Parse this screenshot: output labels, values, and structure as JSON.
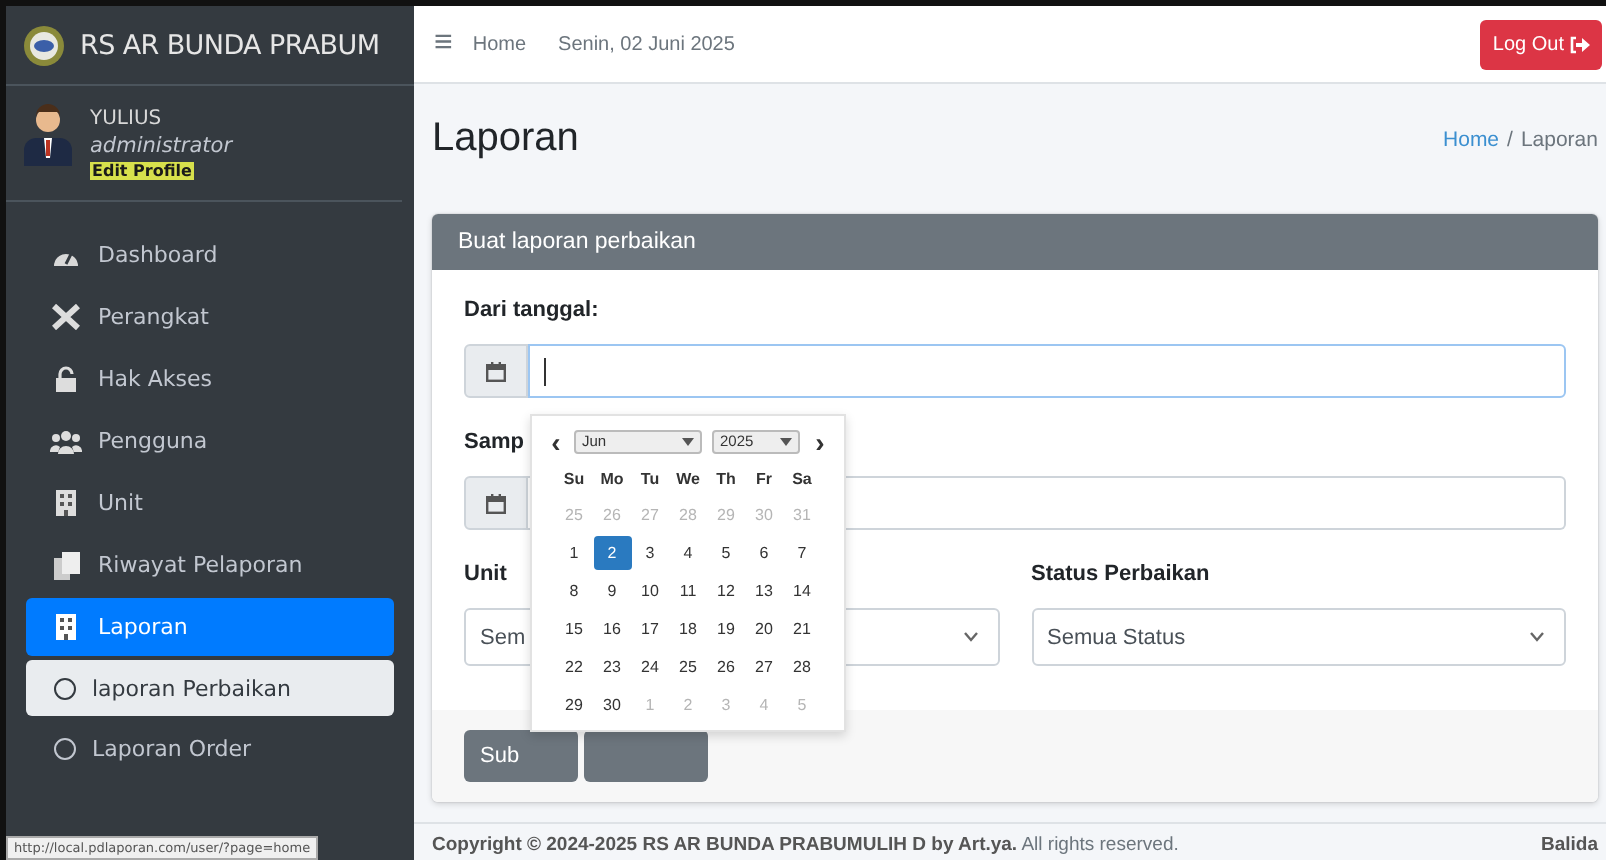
{
  "brand": {
    "name": "RS AR BUNDA PRABUM"
  },
  "user": {
    "name": "YULIUS",
    "role": "administrator",
    "edit_link": "Edit Profile"
  },
  "sidebar": {
    "items": [
      {
        "label": "Dashboard",
        "selected": false
      },
      {
        "label": "Perangkat",
        "selected": false
      },
      {
        "label": "Hak Akses",
        "selected": false
      },
      {
        "label": "Pengguna",
        "selected": false
      },
      {
        "label": "Unit",
        "selected": false
      },
      {
        "label": "Riwayat Pelaporan",
        "selected": false
      },
      {
        "label": "Laporan",
        "selected": true,
        "expanded": true,
        "children": [
          {
            "label": "laporan Perbaikan",
            "selected": true
          },
          {
            "label": "Laporan Order",
            "selected": false
          }
        ]
      }
    ]
  },
  "topbar": {
    "menu_glyph": "≡",
    "home": "Home",
    "date": "Senin, 02 Juni 2025",
    "logout": "Log Out"
  },
  "page": {
    "title": "Laporan",
    "breadcrumb": [
      {
        "label": "Home",
        "link": true
      },
      {
        "label": "Laporan",
        "link": false
      }
    ],
    "breadcrumb_separator": "/"
  },
  "form": {
    "header": "Buat laporan perbaikan",
    "from": {
      "label": "Dari tanggal:",
      "focused": true
    },
    "to": {
      "label": "Samp",
      "focused": false
    },
    "unit": {
      "label": "Unit",
      "value": "Sem"
    },
    "status": {
      "label": "Status Perbaikan",
      "value": "Semua Status"
    },
    "buttons": [
      {
        "kind": "primary",
        "label": "Sub"
      },
      {
        "kind": "secondary"
      }
    ]
  },
  "datepicker": {
    "prev": "‹",
    "next": "›",
    "month": "Jun",
    "year": "2025",
    "weekdays": [
      "Su",
      "Mo",
      "Tu",
      "We",
      "Th",
      "Fr",
      "Sa"
    ],
    "weeks": [
      [
        {
          "day": "25",
          "muted": true,
          "selected": false
        },
        {
          "day": "26",
          "muted": true,
          "selected": false
        },
        {
          "day": "27",
          "muted": true,
          "selected": false
        },
        {
          "day": "28",
          "muted": true,
          "selected": false
        },
        {
          "day": "29",
          "muted": true,
          "selected": false
        },
        {
          "day": "30",
          "muted": true,
          "selected": false
        },
        {
          "day": "31",
          "muted": true,
          "selected": false
        }
      ],
      [
        {
          "day": "1",
          "muted": false,
          "selected": false
        },
        {
          "day": "2",
          "muted": false,
          "selected": true
        },
        {
          "day": "3",
          "muted": false,
          "selected": false
        },
        {
          "day": "4",
          "muted": false,
          "selected": false
        },
        {
          "day": "5",
          "muted": false,
          "selected": false
        },
        {
          "day": "6",
          "muted": false,
          "selected": false
        },
        {
          "day": "7",
          "muted": false,
          "selected": false
        }
      ],
      [
        {
          "day": "8",
          "muted": false,
          "selected": false
        },
        {
          "day": "9",
          "muted": false,
          "selected": false
        },
        {
          "day": "10",
          "muted": false,
          "selected": false
        },
        {
          "day": "11",
          "muted": false,
          "selected": false
        },
        {
          "day": "12",
          "muted": false,
          "selected": false
        },
        {
          "day": "13",
          "muted": false,
          "selected": false
        },
        {
          "day": "14",
          "muted": false,
          "selected": false
        }
      ],
      [
        {
          "day": "15",
          "muted": false,
          "selected": false
        },
        {
          "day": "16",
          "muted": false,
          "selected": false
        },
        {
          "day": "17",
          "muted": false,
          "selected": false
        },
        {
          "day": "18",
          "muted": false,
          "selected": false
        },
        {
          "day": "19",
          "muted": false,
          "selected": false
        },
        {
          "day": "20",
          "muted": false,
          "selected": false
        },
        {
          "day": "21",
          "muted": false,
          "selected": false
        }
      ],
      [
        {
          "day": "22",
          "muted": false,
          "selected": false
        },
        {
          "day": "23",
          "muted": false,
          "selected": false
        },
        {
          "day": "24",
          "muted": false,
          "selected": false
        },
        {
          "day": "25",
          "muted": false,
          "selected": false
        },
        {
          "day": "26",
          "muted": false,
          "selected": false
        },
        {
          "day": "27",
          "muted": false,
          "selected": false
        },
        {
          "day": "28",
          "muted": false,
          "selected": false
        }
      ],
      [
        {
          "day": "29",
          "muted": false,
          "selected": false
        },
        {
          "day": "30",
          "muted": false,
          "selected": false
        },
        {
          "day": "1",
          "muted": true,
          "selected": false
        },
        {
          "day": "2",
          "muted": true,
          "selected": false
        },
        {
          "day": "3",
          "muted": true,
          "selected": false
        },
        {
          "day": "4",
          "muted": true,
          "selected": false
        },
        {
          "day": "5",
          "muted": true,
          "selected": false
        }
      ]
    ]
  },
  "footer": {
    "copyright": "Copyright © 2024-2025 RS AR BUNDA PRABUMULIH D by Art.ya.",
    "rights": "All rights reserved.",
    "right": "Balida"
  },
  "status_url": "http://local.pdlaporan.com/user/?page=home"
}
